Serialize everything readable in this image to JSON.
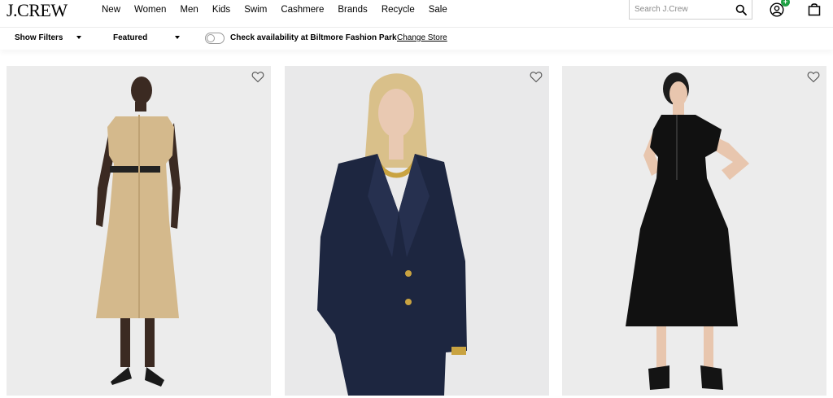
{
  "header": {
    "logo": "J.CREW",
    "nav": [
      "New",
      "Women",
      "Men",
      "Kids",
      "Swim",
      "Cashmere",
      "Brands",
      "Recycle",
      "Sale"
    ],
    "search_placeholder": "Search J.Crew",
    "account_badge": "+",
    "icons": {
      "search": "search-icon",
      "account": "account-icon",
      "bag": "shopping-bag-icon"
    }
  },
  "filterbar": {
    "show_filters": "Show Filters",
    "sort": "Featured",
    "availability": "Check availability at Biltmore Fashion Park",
    "change_store": "Change Store"
  },
  "products": [
    {
      "image": "woman in khaki belted midi shirtdress with black slingback heels",
      "favorite_icon": "heart-icon"
    },
    {
      "image": "woman in navy double-breasted blazer with gold chain necklace",
      "favorite_icon": "heart-icon"
    },
    {
      "image": "woman in black short-sleeve midi shirtdress with mary jane shoes",
      "favorite_icon": "heart-icon"
    }
  ],
  "colors": {
    "background": "#ffffff",
    "card_background": "#ececec",
    "badge": "#1fa043",
    "khaki": "#d4b98c",
    "navy": "#1d2640",
    "black_dress": "#111111"
  }
}
